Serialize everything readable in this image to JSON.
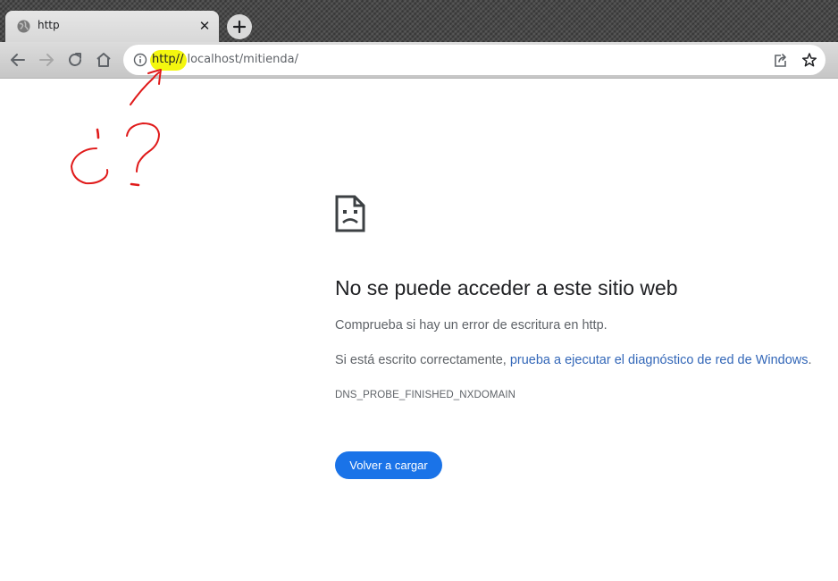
{
  "browser": {
    "tab": {
      "title": "http",
      "close_glyph": "✕",
      "favicon": "globe-icon"
    },
    "new_tab_icon": "plus-icon",
    "nav": {
      "back_icon": "arrow-left-icon",
      "forward_icon": "arrow-right-icon",
      "reload_icon": "reload-icon",
      "home_icon": "home-icon"
    },
    "omnibox": {
      "site_info_icon": "info-icon",
      "url_highlighted": "http//",
      "url_rest": "localhost/mitienda/",
      "share_icon": "share-icon",
      "bookmark_icon": "star-icon"
    }
  },
  "annotation": {
    "text": "¿?",
    "color": "#e01a1a",
    "highlight_color": "#f4f70f"
  },
  "error_page": {
    "icon": "sad-page-icon",
    "heading": "No se puede acceder a este sitio web",
    "line1": "Comprueba si hay un error de escritura en http.",
    "line2_prefix": "Si está escrito correctamente, ",
    "line2_link": "prueba a ejecutar el diagnóstico de red de Windows",
    "line2_suffix": ".",
    "error_code": "DNS_PROBE_FINISHED_NXDOMAIN",
    "reload_button": "Volver a cargar"
  },
  "colors": {
    "accent": "#1a73e8",
    "link": "#3367b8",
    "text": "#202124",
    "secondary_text": "#5f6368"
  }
}
